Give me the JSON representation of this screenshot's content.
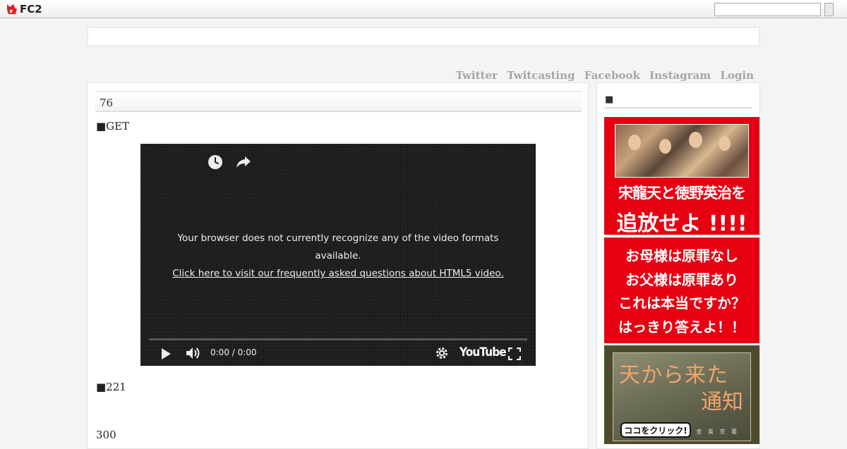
{
  "topbar": {
    "logo_text": "FC2",
    "search_value": ""
  },
  "nav": {
    "links": [
      "Twitter",
      "Twitcasting",
      "Facebook",
      "Instagram",
      "Login"
    ]
  },
  "post": {
    "title": "76",
    "line_get": "■GET",
    "line_221": "■221",
    "line_300": "300"
  },
  "player": {
    "message_line": "Your browser does not currently recognize any of the video formats available.",
    "faq_link": "Click here to visit our frequently asked questions about HTML5 video.",
    "time": "0:00 / 0:00",
    "brand": "YouTube"
  },
  "sidebar": {
    "heading": "■",
    "ad1": {
      "line1": "宋龍天と徳野英治を",
      "line2": "追放せよ !!!!"
    },
    "ad2": {
      "lines": [
        "お母様は原罪なし",
        "お父様は原罪あり",
        "これは本当ですか？",
        "はっきり答えよ！！"
      ]
    },
    "ad3": {
      "title1": "天から来た",
      "title2": "通知",
      "button": "ココをクリック!",
      "author": "金 美 京 著"
    }
  },
  "colors": {
    "ad_red": "#e60012",
    "nav_gray": "#a6a6a6",
    "player_bg": "#1c1c1c"
  }
}
